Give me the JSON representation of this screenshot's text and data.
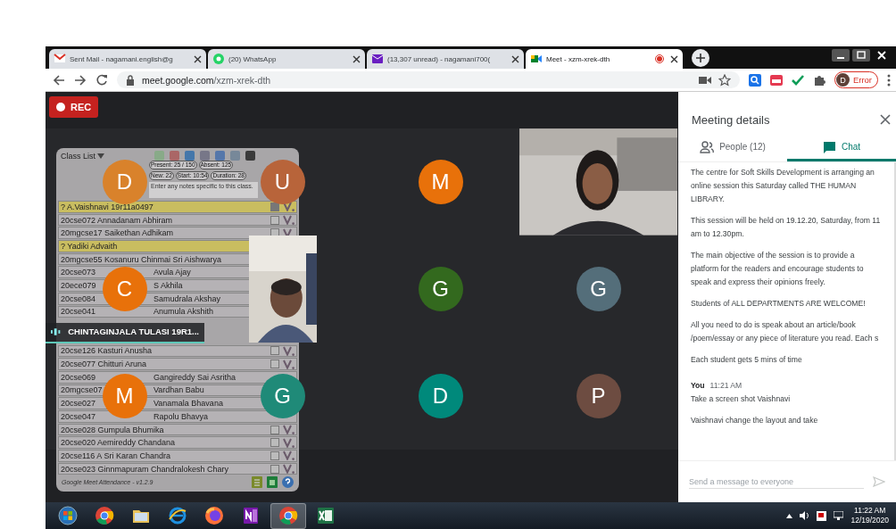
{
  "browser": {
    "tabs": [
      {
        "kind": "mail",
        "title": "Sent Mail - nagamani.english@g",
        "selected": false
      },
      {
        "kind": "chat",
        "title": "(20) WhatsApp",
        "selected": false
      },
      {
        "kind": "inbox",
        "title": "(13,307 unread) - nagamani700(",
        "selected": false
      },
      {
        "kind": "meet",
        "title": "Meet - xzm-xrek-dth",
        "selected": true,
        "recording": true
      }
    ],
    "url_host": "meet.google.com",
    "url_path": "/xzm-xrek-dth",
    "profile": {
      "initial": "D",
      "label": "Error"
    }
  },
  "meet": {
    "rec_label": "REC",
    "tiles": [
      {
        "kind": "avatar",
        "initial": "D",
        "color": "#d9822b"
      },
      {
        "kind": "avatar",
        "initial": "U",
        "color": "#b8643a"
      },
      {
        "kind": "avatar",
        "initial": "M",
        "color": "#e8710a"
      },
      {
        "kind": "video_wide"
      },
      {
        "kind": "avatar",
        "initial": "C",
        "color": "#e8710a"
      },
      {
        "kind": "video_narrow"
      },
      {
        "kind": "avatar",
        "initial": "G",
        "color": "#33691e"
      },
      {
        "kind": "avatar",
        "initial": "G",
        "color": "#546e7a"
      },
      {
        "kind": "avatar",
        "initial": "M",
        "color": "#e8710a"
      },
      {
        "kind": "avatar",
        "initial": "G",
        "color": "#1f8a78"
      },
      {
        "kind": "avatar",
        "initial": "D",
        "color": "#00897b"
      },
      {
        "kind": "avatar",
        "initial": "P",
        "color": "#6d4c41"
      }
    ],
    "speaker": {
      "name": "CHINTAGINJALA TULASI 19R1..."
    }
  },
  "class_list": {
    "title": "Class List",
    "stats": [
      "Present: 25 / 150",
      "Absent: 125",
      "New: 22",
      "Start: 10:54",
      "Duration: 28"
    ],
    "notes_placeholder": "Enter any notes specific to this class.",
    "rows": [
      {
        "kind": "student",
        "name": "? A.Vaishnavi 19r11a0497",
        "highlighted": true,
        "checked": true
      },
      {
        "kind": "student",
        "name": "20cse072 Annadanam Abhiram",
        "highlighted": false,
        "checked": false
      },
      {
        "kind": "student",
        "name": "20mgcse17 Saikethan Adhikam",
        "highlighted": false,
        "checked": false
      },
      {
        "kind": "student",
        "name": "? Yadiki Advaith",
        "highlighted": true
      },
      {
        "kind": "student",
        "name": "20mgcse55 Kosanuru Chinmai Sri Aishwarya",
        "highlighted": false
      },
      {
        "kind": "split",
        "code": "20cse073",
        "name": "Avula Ajay",
        "highlighted": false
      },
      {
        "kind": "split",
        "code": "20ece079",
        "name": "S Akhila",
        "highlighted": false
      },
      {
        "kind": "split",
        "code": "20cse084",
        "name": "Samudrala Akshay",
        "highlighted": false
      },
      {
        "kind": "split",
        "code": "20cse041",
        "name": "Anumula Akshith",
        "highlighted": false
      },
      {
        "kind": "covered"
      },
      {
        "kind": "covered"
      },
      {
        "kind": "student",
        "name": "20cse126 Kasturi Anusha",
        "highlighted": false,
        "checked": false
      },
      {
        "kind": "student",
        "name": "20cse077 Chitturi Aruna",
        "highlighted": false,
        "checked": false
      },
      {
        "kind": "split",
        "code": "20cse069",
        "name": "Gangireddy Sai Asritha",
        "highlighted": false
      },
      {
        "kind": "split",
        "code": "20mgcse07",
        "name": "Vardhan Babu",
        "highlighted": false
      },
      {
        "kind": "split",
        "code": "20cse027",
        "name": "Vanamala Bhavana",
        "highlighted": false
      },
      {
        "kind": "split",
        "code": "20cse047",
        "name": "Rapolu Bhavya",
        "highlighted": false
      },
      {
        "kind": "student",
        "name": "20cse028 Gumpula Bhumika",
        "highlighted": false,
        "checked": false
      },
      {
        "kind": "student",
        "name": "20cse020 Aemireddy Chandana",
        "highlighted": false,
        "checked": false
      },
      {
        "kind": "student",
        "name": "20cse116 A Sri Karan Chandra",
        "highlighted": false,
        "checked": false
      },
      {
        "kind": "student",
        "name": "20cse023 Ginnmapuram Chandralokesh Chary",
        "highlighted": false,
        "checked": false
      }
    ],
    "footer": "Google Meet Attendance - v1.2.9"
  },
  "side_panel": {
    "title": "Meeting details",
    "tabs": [
      {
        "kind": "people",
        "label": "People (12)",
        "selected": false
      },
      {
        "kind": "chat",
        "label": "Chat",
        "selected": true
      }
    ],
    "messages": [
      {
        "kind": "text",
        "text": "The centre for Soft Skills Development is arranging an online session this Saturday called THE HUMAN LIBRARY."
      },
      {
        "kind": "text",
        "text": "This session will be held on 19.12.20, Saturday, from 11 am to 12.30pm."
      },
      {
        "kind": "text",
        "text": "The main objective of the session is to provide a platform for the readers and encourage students to speak and express their opinions freely."
      },
      {
        "kind": "text",
        "text": "Students of ALL DEPARTMENTS ARE WELCOME!"
      },
      {
        "kind": "text",
        "text": "All you need to do is speak about an article/book /poem/essay or any piece of literature you read. Each s"
      },
      {
        "kind": "text",
        "text": "Each student gets 5 mins of time"
      },
      {
        "kind": "header",
        "sender": "You",
        "time": "11:21 AM"
      },
      {
        "kind": "text",
        "text": "Take a screen shot Vaishnavi"
      },
      {
        "kind": "text",
        "text": "Vaishnavi change the layout and take"
      }
    ],
    "input_placeholder": "Send a message to everyone"
  },
  "taskbar": {
    "apps": [
      {
        "kind": "start",
        "selected": false
      },
      {
        "kind": "chrome",
        "selected": false
      },
      {
        "kind": "folder",
        "selected": false
      },
      {
        "kind": "ie",
        "selected": false
      },
      {
        "kind": "firefox",
        "selected": false
      },
      {
        "kind": "onenote",
        "selected": false
      },
      {
        "kind": "chrome",
        "selected": true
      },
      {
        "kind": "excel",
        "selected": false
      }
    ],
    "time": "11:22 AM",
    "date": "12/19/2020"
  }
}
